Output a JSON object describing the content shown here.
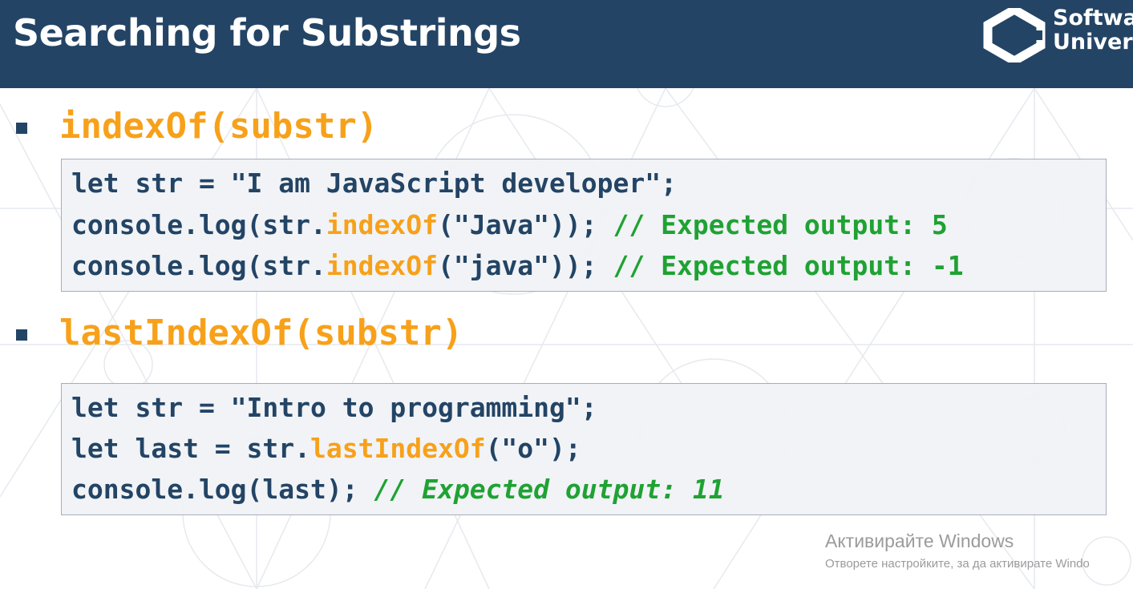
{
  "slide": {
    "title": "Searching for Substrings"
  },
  "logo": {
    "icon": "softuni-logo-icon",
    "line1": "Softwa",
    "line2": "Univer"
  },
  "sections": [
    {
      "heading": "indexOf(substr)",
      "code": [
        {
          "pre": "let str = \"I am JavaScript developer\";"
        },
        {
          "pre": "console.log(str.",
          "method": "indexOf",
          "post": "(\"Java\")); ",
          "comment": "// Expected output: 5"
        },
        {
          "pre": "console.log(str.",
          "method": "indexOf",
          "post": "(\"java\")); ",
          "comment": "// Expected output: -1"
        }
      ]
    },
    {
      "heading": "lastIndexOf(substr)",
      "code": [
        {
          "pre": "let str = \"Intro to programming\";"
        },
        {
          "pre": "let last = str.",
          "method": "lastIndexOf",
          "post": "(\"o\");"
        },
        {
          "pre": "console.log(last); ",
          "comment": "// Expected output: 11"
        }
      ]
    }
  ],
  "watermark": {
    "line1": "Активирайте Windows",
    "line2": "Отворете настройките, за да активирате Windo"
  },
  "colors": {
    "header": "#234465",
    "heading": "#f7a11a",
    "code_text": "#234465",
    "comment": "#1fa233"
  }
}
